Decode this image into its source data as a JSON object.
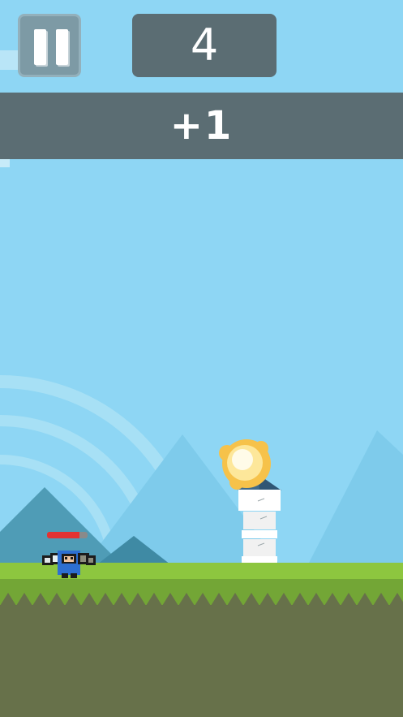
{
  "hud": {
    "score": "4",
    "bonus": "+1",
    "pause_icon": "pause-icon"
  },
  "player": {
    "health_fraction": 0.8
  },
  "colors": {
    "sky": "#8ed6f4",
    "grass": "#8dc63f",
    "ground": "#67714a",
    "hud_panel": "#5b6d73",
    "mountain": "#4c98b3",
    "health": "#e33232"
  }
}
